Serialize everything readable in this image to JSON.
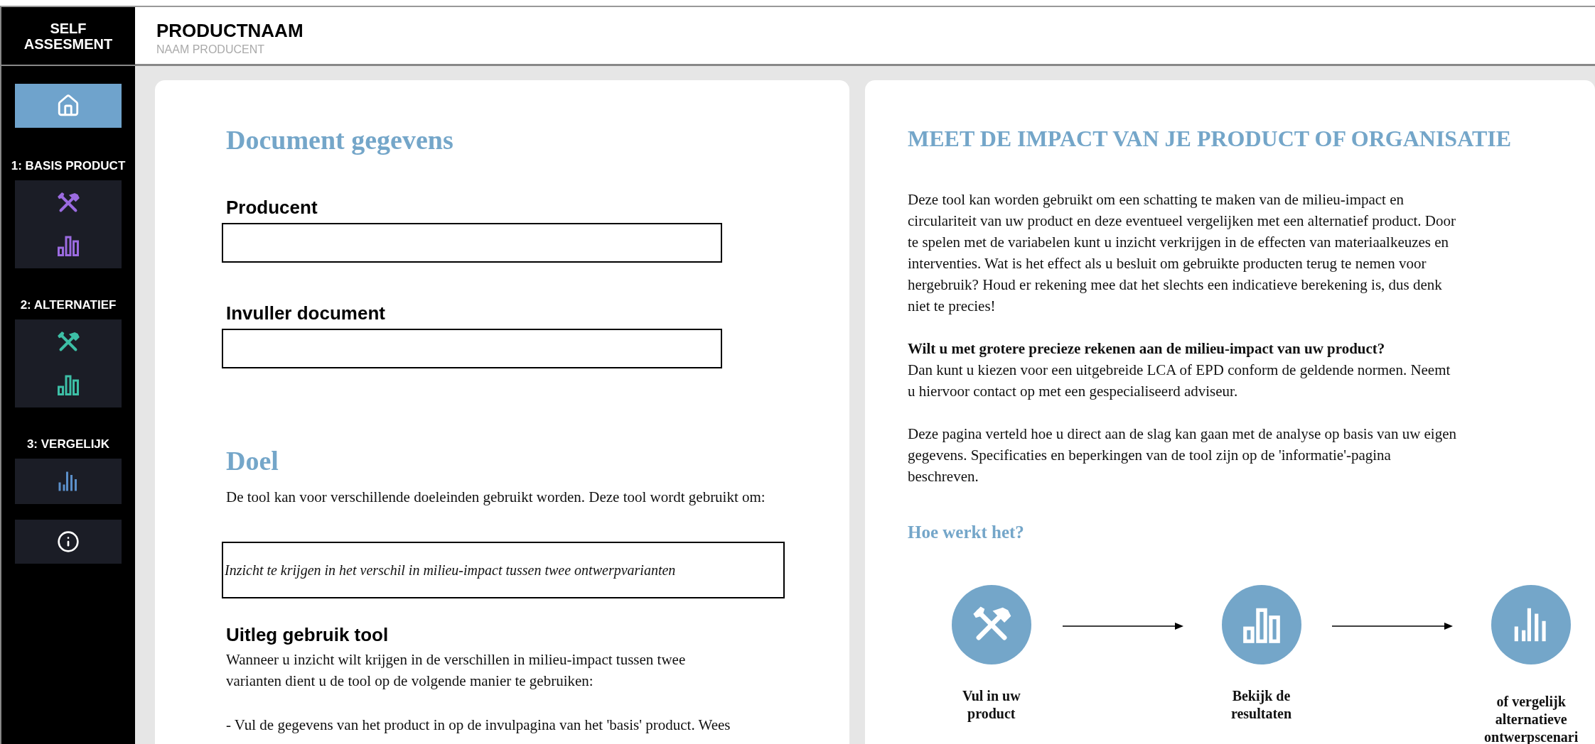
{
  "app": {
    "title_line_1": "SELF",
    "title_line_2": "ASSESMENT"
  },
  "header": {
    "title": "PRODUCTNAAM",
    "subtitle": "NAAM PRODUCENT"
  },
  "sidebar": {
    "items": [
      {
        "kind": "home",
        "selected": true
      },
      {
        "kind": "section",
        "label": "1: BASIS PRODUCT",
        "color": "#9b6be0",
        "selected": false
      },
      {
        "kind": "section",
        "label": "2: ALTERNATIEF",
        "color": "#3dbfa6",
        "selected": false
      },
      {
        "kind": "compare",
        "label": "3: VERGELIJK",
        "color": "#5b8fc9",
        "selected": false
      },
      {
        "kind": "info",
        "selected": false
      }
    ]
  },
  "document": {
    "title": "Document gegevens",
    "fields": [
      {
        "label": "Producent"
      },
      {
        "label": "Invuller document"
      }
    ]
  },
  "goal": {
    "title": "Doel",
    "intro": "De tool kan voor verschillende doeleinden gebruikt worden.  Deze tool wordt gebruikt om:",
    "value": "Inzicht te krijgen in het verschil in milieu-impact tussen twee ontwerpvarianten"
  },
  "usage": {
    "title": "Uitleg gebruik tool",
    "paragraphs": [
      "Wanneer u inzicht wilt krijgen in de verschillen in milieu-impact tussen twee varianten dient u de tool op de volgende manier te gebruiken:",
      "- Vul de gegevens van het product in op de invulpagina van het 'basis' product. Wees"
    ]
  },
  "intro": {
    "title": "MEET DE IMPACT VAN JE PRODUCT OF ORGANISATIE",
    "paragraphs": [
      "Deze tool kan worden gebruikt om een schatting te maken van de milieu-impact en circulariteit van uw product en deze eventueel vergelijken met een alternatief product. Door te spelen met de variabelen kunt u inzicht verkrijgen in de effecten van materiaalkeuzes en interventies. Wat is het effect als u besluit om gebruikte producten terug te nemen voor hergebruik? Houd er rekening mee dat het slechts een indicatieve berekening is, dus denk niet te precies!",
      "**Wilt u met grotere precieze rekenen aan de milieu-impact van uw product?**",
      "Dan kunt u kiezen voor een uitgebreide LCA of EPD conform de geldende normen. Neemt u hiervoor contact op met een gespecialiseerd adviseur.",
      "Deze pagina verteld hoe u direct aan de slag kan gaan met de analyse op basis van uw eigen gegevens. Specificaties en beperkingen van de tool zijn op de 'informatie'-pagina beschreven."
    ]
  },
  "how": {
    "title": "Hoe werkt het?",
    "steps": [
      {
        "kind": "input",
        "label": "Vul in uw product"
      },
      {
        "kind": "results",
        "label": "Bekijk de resultaten"
      },
      {
        "kind": "compare",
        "label": "of vergelijk alternatieve ontwerpscenari"
      }
    ]
  }
}
